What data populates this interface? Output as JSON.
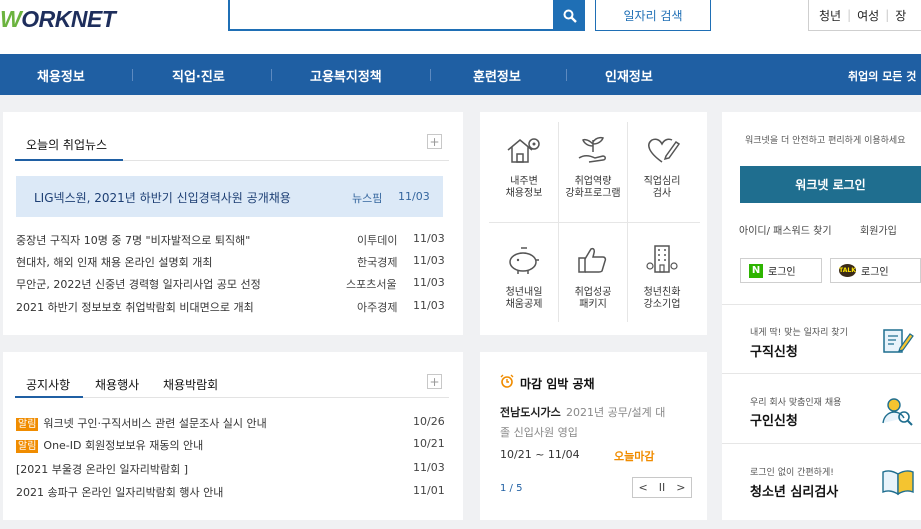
{
  "header": {
    "logo_text": "WORKNET",
    "search_placeholder": "",
    "job_search_label": "일자리 검색",
    "quick_links": [
      "청년",
      "여성",
      "장"
    ]
  },
  "nav": {
    "items": [
      "채용정보",
      "직업·진로",
      "고용복지정책",
      "훈련정보",
      "인재정보"
    ],
    "right_label": "취업의 모든 것"
  },
  "news": {
    "title": "오늘의 취업뉴스",
    "more_label": "+",
    "featured": {
      "title": "LIG넥스원, 2021년 하반기 신입경력사원 공개채용",
      "source": "뉴스핌",
      "date": "11/03"
    },
    "rows": [
      {
        "title": "중장년 구직자 10명 중 7명 \"비자발적으로 퇴직해\"",
        "source": "이투데이",
        "date": "11/03"
      },
      {
        "title": "현대차, 해외 인재 채용 온라인 설명회 개최",
        "source": "한국경제",
        "date": "11/03"
      },
      {
        "title": "무안군, 2022년 신중년 경력형 일자리사업 공모 선정",
        "source": "스포츠서울",
        "date": "11/03"
      },
      {
        "title": "2021 하반기 정보보호 취업박람회 비대면으로 개최",
        "source": "아주경제",
        "date": "11/03"
      }
    ]
  },
  "notices": {
    "tabs": [
      "공지사항",
      "채용행사",
      "채용박람회"
    ],
    "more_label": "+",
    "rows": [
      {
        "badge": "알림",
        "title": "워크넷 구인·구직서비스 관련 설문조사 실시 안내",
        "date": "10/26"
      },
      {
        "badge": "알림",
        "title": "One-ID 회원정보보유 재동의 안내",
        "date": "10/21"
      },
      {
        "badge": "",
        "title": "[2021 부울경 온라인 일자리박람회 ]",
        "date": "11/03"
      },
      {
        "badge": "",
        "title": "2021 송파구 온라인 일자리박람회 행사 안내",
        "date": "11/01"
      }
    ]
  },
  "grid_menu": {
    "items": [
      {
        "label": "내주변\n채용정보",
        "icon": "house-map-icon"
      },
      {
        "label": "취업역량\n강화프로그램",
        "icon": "sprout-hand-icon"
      },
      {
        "label": "직업심리\n검사",
        "icon": "heart-pen-icon"
      },
      {
        "label": "청년내일\n채움공제",
        "icon": "piggy-bank-icon"
      },
      {
        "label": "취업성공\n패키지",
        "icon": "thumbs-up-icon"
      },
      {
        "label": "청년친화\n강소기업",
        "icon": "building-icon"
      }
    ]
  },
  "deadline": {
    "title": "마감 임박 공채",
    "company": "전남도시가스",
    "line1": "2021년 공무/설계 대",
    "line2": "졸 신입사원 영입",
    "period": "10/21 ~ 11/04",
    "badge": "오늘마감",
    "page": "1 / 5",
    "controls": [
      "<",
      "II",
      ">"
    ]
  },
  "login": {
    "intro": "워크넷을 더 안전하고 편리하게 이용하세요",
    "login_button": "워크넷 로그인",
    "find_id": "아이디/ 패스워드 찾기",
    "join": "회원가입",
    "naver_label": "로그인",
    "kakao_label": "로그인",
    "naver_badge": "N",
    "kakao_badge": "TALK"
  },
  "side_links": [
    {
      "small": "내게 딱! 맞는 일자리 찾기",
      "big": "구직신청",
      "icon": "resume-pen-icon"
    },
    {
      "small": "우리 회사 맞춤인재 채용",
      "big": "구인신청",
      "icon": "person-search-icon"
    },
    {
      "small": "로그인 없이 간편하게!",
      "big": "청소년 심리검사",
      "icon": "open-book-icon"
    }
  ],
  "colors": {
    "nav_bg": "#1f5fa3",
    "accent_blue": "#1f6fb5",
    "login_btn": "#1f6e8f",
    "deadline_orange": "#f08c00",
    "logo_green": "#6cb33f"
  }
}
